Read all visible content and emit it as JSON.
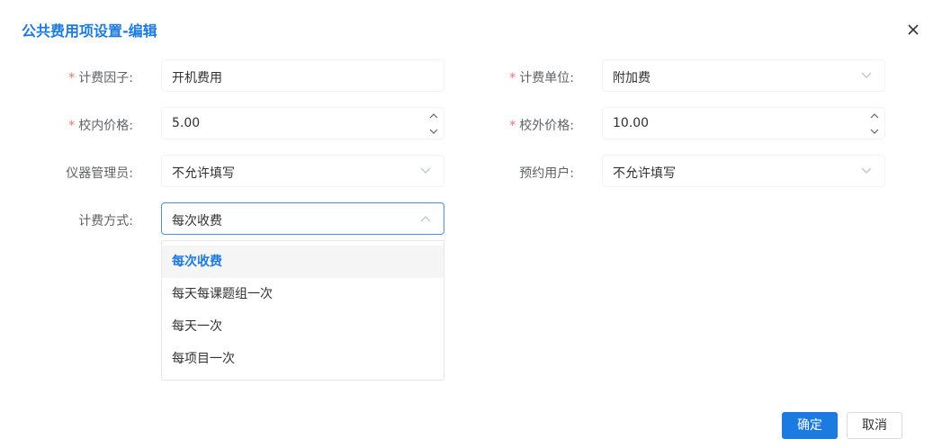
{
  "dialog": {
    "title": "公共费用项设置-编辑"
  },
  "form": {
    "factor": {
      "label": "计费因子:",
      "value": "开机费用",
      "required": true
    },
    "unit": {
      "label": "计费单位:",
      "value": "附加费",
      "required": true
    },
    "internal_price": {
      "label": "校内价格:",
      "value": "5.00",
      "required": true
    },
    "external_price": {
      "label": "校外价格:",
      "value": "10.00",
      "required": true
    },
    "instrument_manager": {
      "label": "仪器管理员:",
      "value": "不允许填写"
    },
    "reserve_user": {
      "label": "预约用户:",
      "value": "不允许填写"
    },
    "billing_method": {
      "label": "计费方式:",
      "value": "每次收费"
    }
  },
  "dropdown": {
    "options": [
      "每次收费",
      "每天每课题组一次",
      "每天一次",
      "每项目一次"
    ],
    "selected_index": 0
  },
  "footer": {
    "confirm_label": "确定",
    "cancel_label": "取消"
  },
  "colors": {
    "accent": "#1c7be0",
    "required": "#f56c6c"
  },
  "icons": {
    "close": "close-icon",
    "select_arrow": "chevron-down-icon",
    "spin_up": "chevron-up-icon",
    "spin_down": "chevron-down-icon"
  }
}
